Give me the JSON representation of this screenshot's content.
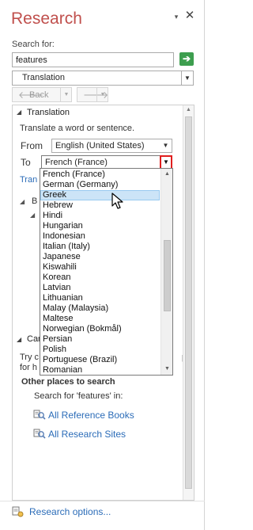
{
  "pane": {
    "title": "Research",
    "menu_icon": "▾",
    "close_icon": "✕"
  },
  "search": {
    "label": "Search for:",
    "value": "features",
    "go_icon": "➔"
  },
  "source": {
    "selected": "Translation",
    "arrow": "▼"
  },
  "nav": {
    "back_label": "Back",
    "back_icon": "🡐",
    "forward_icon": "🡒",
    "drop_icon": "▼"
  },
  "translation": {
    "section_title": "Translation",
    "toggle": "◢",
    "description": "Translate a word or sentence.",
    "from_label": "From",
    "from_value": "English (United States)",
    "to_label": "To",
    "to_value": "French (France)",
    "options_link": "Tran",
    "bilingual_toggle": "◢",
    "bilingual_label": "B",
    "sub_toggle": "◢"
  },
  "can": {
    "toggle": "◢",
    "title": "Can",
    "try_text": "Try c",
    "try_text_tail": "p",
    "try_text2": "for h"
  },
  "languages": [
    "French (France)",
    "German (Germany)",
    "Greek",
    "Hebrew",
    "Hindi",
    "Hungarian",
    "Indonesian",
    "Italian (Italy)",
    "Japanese",
    "Kiswahili",
    "Korean",
    "Latvian",
    "Lithuanian",
    "Malay (Malaysia)",
    "Maltese",
    "Norwegian (Bokmål)",
    "Persian",
    "Polish",
    "Portuguese (Brazil)",
    "Romanian"
  ],
  "languages_highlighted": "Greek",
  "other_places": {
    "heading": "Other places to search",
    "search_for_label": "Search for 'features' in:",
    "links": [
      "All Reference Books",
      "All Research Sites"
    ]
  },
  "footer": {
    "options_link": "Research options..."
  },
  "colors": {
    "title": "#c0504d",
    "link": "#2b6cb8",
    "go_button": "#3d9e4f",
    "highlight_outline": "#e01f1f",
    "selected_item": "#cce4f7"
  }
}
